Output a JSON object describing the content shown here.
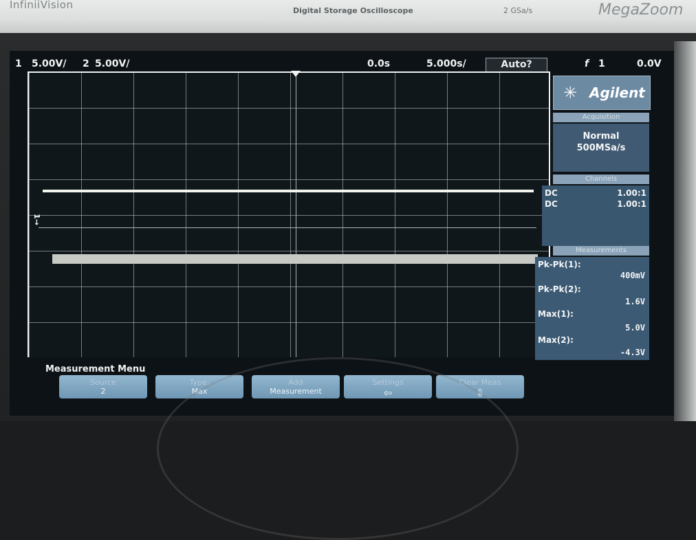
{
  "bezel": {
    "brand_left": "InfiniiVision",
    "title": "Digital Storage Oscilloscope",
    "sample_rate": "2 GSa/s",
    "brand_right": "MegaZoom"
  },
  "status_bar": {
    "ch1_num": "1",
    "ch1_scale": "5.00V/",
    "ch2_num": "2",
    "ch2_scale": "5.00V/",
    "time_delay": "0.0s",
    "time_scale": "5.000s/",
    "trigger_mode": "Auto?",
    "trigger_icon": "f",
    "trigger_source": "1",
    "trigger_level": "0.0V"
  },
  "panel": {
    "logo": "Agilent",
    "acquisition": {
      "header": "Acquisition",
      "mode": "Normal",
      "rate": "500MSa/s"
    },
    "probe": {
      "header": "Channels",
      "rows": [
        {
          "coupling": "DC",
          "ratio": "1.00:1"
        },
        {
          "coupling": "DC",
          "ratio": "1.00:1"
        }
      ]
    },
    "measurements": {
      "header": "Measurements",
      "items": [
        {
          "label": "Pk-Pk(1):",
          "value": "400mV"
        },
        {
          "label": "Pk-Pk(2):",
          "value": "1.6V"
        },
        {
          "label": "Max(1):",
          "value": "5.0V"
        },
        {
          "label": "Max(2):",
          "value": "-4.3V"
        }
      ]
    }
  },
  "menu": {
    "title": "Measurement Menu",
    "softkeys": [
      {
        "top": "Source",
        "bottom": "2"
      },
      {
        "top": "Type:",
        "bottom": "Max"
      },
      {
        "top": "Add",
        "bottom": "Measurement"
      },
      {
        "top": "Settings",
        "bottom": "⇦"
      },
      {
        "top": "Clear Meas",
        "bottom": "⇩"
      }
    ]
  },
  "colors": {
    "screen_bg": "#0d1216",
    "panel_blue": "#3f5a72",
    "softkey_blue": "#7fa6c2",
    "trace": "#f3f4ee"
  }
}
